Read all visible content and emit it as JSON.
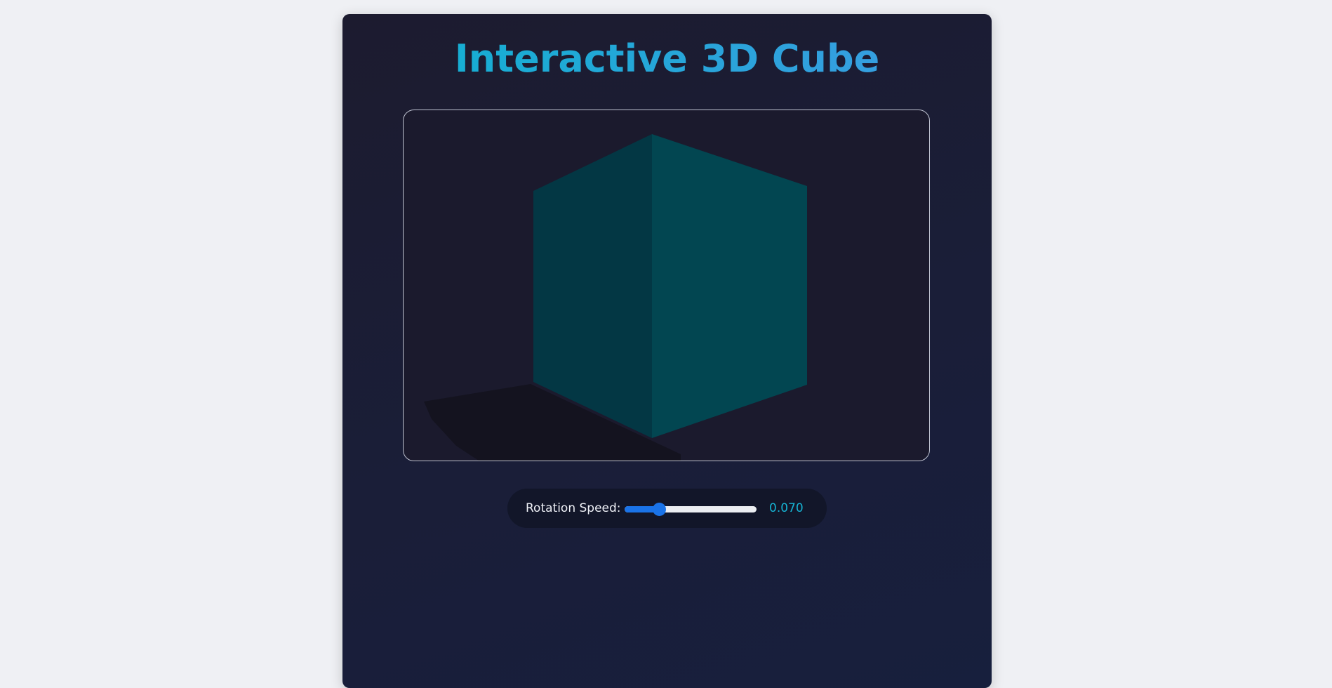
{
  "page": {
    "title": "Interactive 3D Cube"
  },
  "scene": {
    "object": "cube",
    "colors": {
      "face_left": "#033744",
      "face_right": "#024651",
      "shadow": "#14131f",
      "background": "#1b1a2d"
    }
  },
  "controls": {
    "rotation_speed": {
      "label": "Rotation Speed:",
      "value_text": "0.070",
      "fraction": 0.26
    }
  },
  "colors": {
    "accent": "#1a73e8",
    "value_text": "#16b4d4",
    "title_gradient_start": "#0fb1cf",
    "title_gradient_end": "#3d9be3"
  }
}
